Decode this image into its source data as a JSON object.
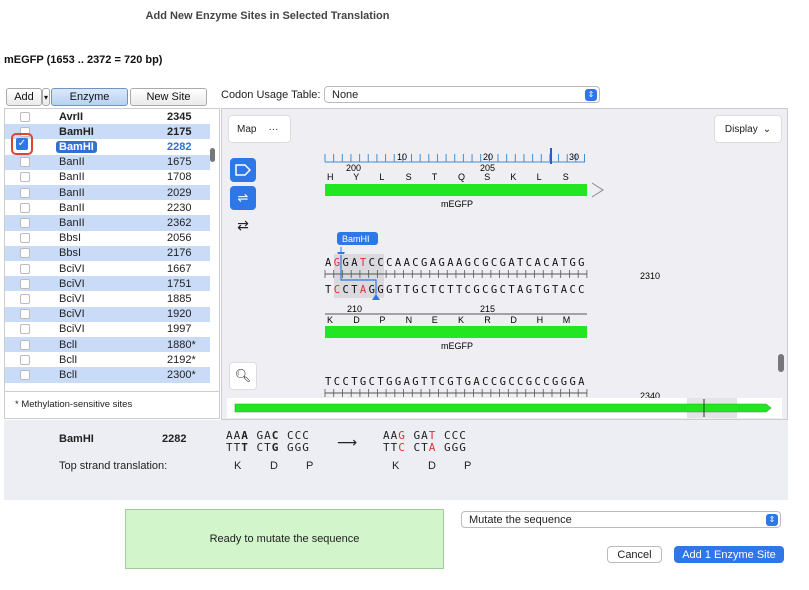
{
  "dialog": {
    "title": "Add New Enzyme Sites in Selected Translation",
    "sequence_header": "mEGFP  (1653 .. 2372  =  720 bp)"
  },
  "toolbar": {
    "add_label": "Add",
    "enzyme_tab": "Enzyme",
    "newsite_tab": "New Site",
    "codon_label": "Codon Usage Table:",
    "codon_value": "None"
  },
  "enzymes": [
    {
      "name": "AvrII",
      "value": "2345",
      "bold": true
    },
    {
      "name": "BamHI",
      "value": "2175",
      "bold": true
    },
    {
      "name": "BamHI",
      "value": "2282",
      "bold": true,
      "checked": true,
      "selected": true
    },
    {
      "name": "BanII",
      "value": "1675"
    },
    {
      "name": "BanII",
      "value": "1708"
    },
    {
      "name": "BanII",
      "value": "2029"
    },
    {
      "name": "BanII",
      "value": "2230"
    },
    {
      "name": "BanII",
      "value": "2362"
    },
    {
      "name": "BbsI",
      "value": "2056"
    },
    {
      "name": "BbsI",
      "value": "2176"
    },
    {
      "name": "BciVI",
      "value": "1667"
    },
    {
      "name": "BciVI",
      "value": "1751"
    },
    {
      "name": "BciVI",
      "value": "1885"
    },
    {
      "name": "BciVI",
      "value": "1920"
    },
    {
      "name": "BciVI",
      "value": "1997"
    },
    {
      "name": "BclI",
      "value": "1880*"
    },
    {
      "name": "BclI",
      "value": "2192*"
    },
    {
      "name": "BclI",
      "value": "2300*"
    }
  ],
  "methylation_note": "* Methylation-sensitive sites",
  "map": {
    "map_label": "Map",
    "more_label": "···",
    "display_label": "Display",
    "ruler_numbers": [
      "10",
      "20",
      "30"
    ],
    "nt_positions": [
      "200",
      "205",
      "210",
      "215"
    ],
    "translation_1": [
      "H",
      "Y",
      "L",
      "S",
      "T",
      "Q",
      "S",
      "K",
      "L",
      "S"
    ],
    "translation_2": [
      "K",
      "D",
      "P",
      "N",
      "E",
      "K",
      "R",
      "D",
      "H",
      "M"
    ],
    "feature_label_1": "mEGFP",
    "feature_label_2": "mEGFP",
    "enzyme_tag": "BamHI",
    "top_strand": "AGGATCCCAACGAGAAGCGCGATCACATGG",
    "bottom_strand": "TCCTAGGGTTGCTCTTCGCGCTAGTGTACC",
    "line_number_1": "2310",
    "third_strand": "TCCTGCTGGAGTTCGTGACCGCCGCCGGGA",
    "line_number_2": "2340",
    "feature_color": "#22e622"
  },
  "summary": {
    "enzyme": "BamHI",
    "position": "2282",
    "before_top": [
      "AAA",
      "GAC",
      "CCC"
    ],
    "before_bottom": [
      "TTT",
      "CTG",
      "GGG"
    ],
    "after_top": [
      "AAG",
      "GAT",
      "CCC"
    ],
    "after_bottom": [
      "TTC",
      "CTA",
      "GGG"
    ],
    "translation_label": "Top strand translation:",
    "aa_before": [
      "K",
      "D",
      "P"
    ],
    "aa_after": [
      "K",
      "D",
      "P"
    ]
  },
  "status": "Ready to mutate the sequence",
  "action_select": "Mutate the sequence",
  "buttons": {
    "cancel": "Cancel",
    "add_site": "Add 1 Enzyme Site"
  }
}
